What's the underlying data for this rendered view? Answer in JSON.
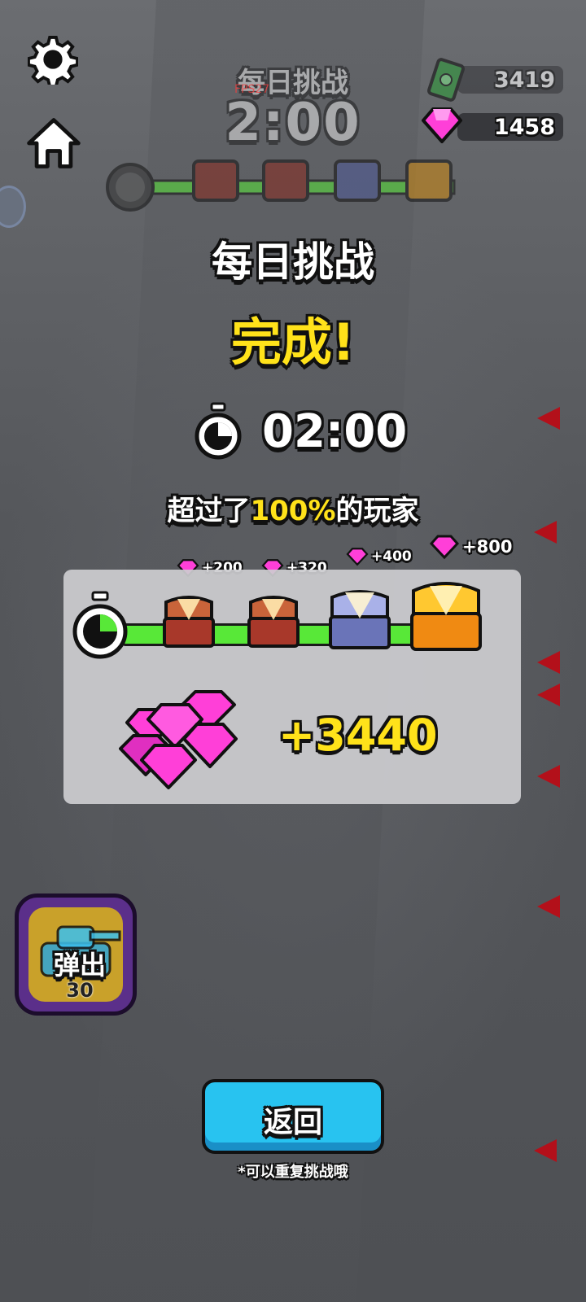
{
  "colors": {
    "accent_yellow": "#ffe21a",
    "progress_green": "#58e838",
    "button_blue": "#28c3f0",
    "gem_pink": "#ff3fd8",
    "panel_gray": "#cdcdd0"
  },
  "hud": {
    "settings_icon": "gear-icon",
    "home_icon": "home-icon",
    "cash_amount": "3419",
    "gem_amount": "1458",
    "top_title": "每日挑战",
    "fps": "FPS27",
    "top_timer": "2:00"
  },
  "result": {
    "title": "每日挑战",
    "status": "完成!",
    "time": "02:00",
    "players_prefix": "超过了",
    "players_percent": "100%",
    "players_suffix": "的玩家"
  },
  "rewards": {
    "milestones": [
      {
        "label": "+200",
        "chest": "bronze"
      },
      {
        "label": "+320",
        "chest": "bronze"
      },
      {
        "label": "+400",
        "chest": "silver"
      },
      {
        "label": "+800",
        "chest": "gold"
      }
    ],
    "progress_fraction": 1.0,
    "total": "+3440"
  },
  "eject": {
    "label": "弹出",
    "count": "30"
  },
  "footer": {
    "return_label": "返回",
    "hint": "*可以重复挑战哦"
  }
}
